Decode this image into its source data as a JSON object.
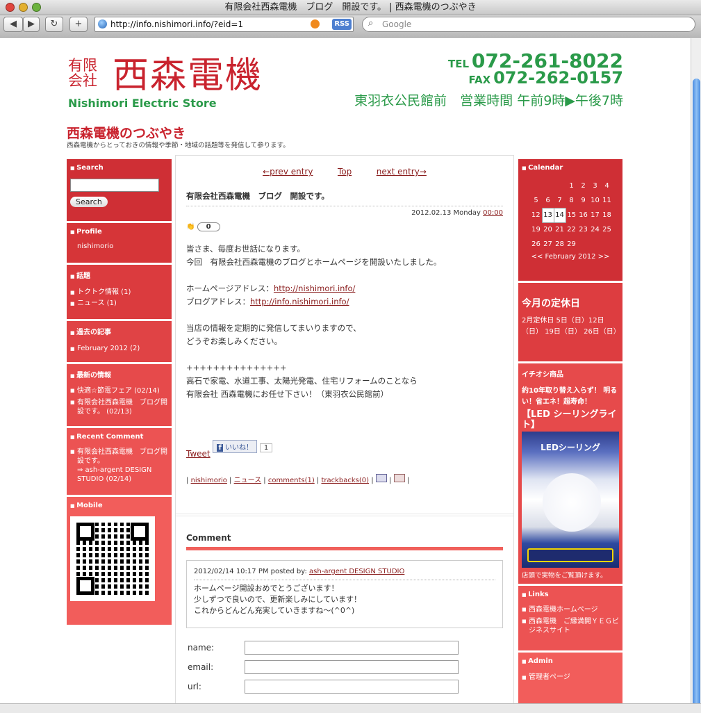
{
  "window": {
    "title": "有限会社西森電機　ブログ　開設です。 | 西森電機のつぶやき"
  },
  "toolbar": {
    "back": "◀",
    "forward": "▶",
    "reload": "↻",
    "add": "+",
    "url": "http://info.nishimori.info/?eid=1",
    "rss": "RSS",
    "search_placeholder": "Google"
  },
  "header": {
    "logo_small": "有限\n会社",
    "logo_main": "西森電機",
    "logo_en": "Nishimori Electric Store",
    "tel_label": "TEL",
    "tel": "072-261-8022",
    "fax_label": "FAX",
    "fax": "072-262-0157",
    "hours": "東羽衣公民館前　営業時間 午前9時▶午後7時"
  },
  "blog": {
    "title": "西森電機のつぶやき",
    "description": "西森電機からとっておきの情報や季節・地域の話題等を発信して参ります。"
  },
  "left": {
    "search_head": "Search",
    "search_button": "Search",
    "profile_head": "Profile",
    "profile_name": "nishimorio",
    "topics_head": "話題",
    "topics": [
      "トクトク情報 (1)",
      "ニュース (1)"
    ],
    "archive_head": "過去の記事",
    "archive": [
      "February 2012 (2)"
    ],
    "recent_head": "最新の情報",
    "recent": [
      "快適☆節電フェア (02/14)",
      "有限会社西森電機　ブログ開設です。 (02/13)"
    ],
    "comment_head": "Recent Comment",
    "comment_item": "有限会社西森電機　ブログ開設です。",
    "comment_by": "⇒ ash-argent DESIGN STUDIO (02/14)",
    "mobile_head": "Mobile"
  },
  "post": {
    "prev": "←prev entry",
    "top": "Top",
    "next": "next entry→",
    "title": "有限会社西森電機　ブログ　開設です。",
    "date": "2012.02.13 Monday",
    "time": "00:00",
    "clap": "0",
    "p1": "皆さま、毎度お世話になります。",
    "p2": "今回　有限会社西森電機のブログとホームページを開設いたしました。",
    "hp_label": "ホームページアドレス：",
    "hp_url": "http://nishimori.info/",
    "blog_label": "ブログアドレス：",
    "blog_url": "http://info.nishimori.info/",
    "p3": "当店の情報を定期的に発信してまいりますので、",
    "p4": "どうぞお楽しみください。",
    "p5": "+++++++++++++++",
    "p6": "高石で家電、水道工事、太陽光発電、住宅リフォームのことなら",
    "p7": "有限会社 西森電機にお任せ下さい！（東羽衣公民館前）",
    "tweet": "Tweet",
    "like": "いいね！",
    "like_count": "1",
    "author": "nishimorio",
    "category": "ニュース",
    "comments": "comments(1)",
    "trackbacks": "trackbacks(0)"
  },
  "comment": {
    "head": "Comment",
    "meta": "2012/02/14 10:17 PM posted by:",
    "author": "ash-argent DESIGN STUDIO",
    "l1": "ホームページ開設おめでとうございます！",
    "l2": "少しずつで良いので、更新楽しみにしています！",
    "l3": "これからどんどん充実していきますね〜(^0^)"
  },
  "form": {
    "name": "name:",
    "email": "email:",
    "url": "url:"
  },
  "right": {
    "cal_head": "Calendar",
    "cal_rows": [
      [
        "",
        "",
        "",
        "1",
        "2",
        "3",
        "4"
      ],
      [
        "5",
        "6",
        "7",
        "8",
        "9",
        "10",
        "11"
      ],
      [
        "12",
        "13",
        "14",
        "15",
        "16",
        "17",
        "18"
      ],
      [
        "19",
        "20",
        "21",
        "22",
        "23",
        "24",
        "25"
      ],
      [
        "26",
        "27",
        "28",
        "29",
        "",
        "",
        ""
      ]
    ],
    "cal_nav": "<< February 2012 >>",
    "holiday_head": "今月の定休日",
    "holiday_text": "2月定休日 5日（日）12日（日） 19日（日） 26日（日）",
    "pick_head": "イチオシ商品",
    "pick_text": "約10年取り替え入らず！ 明るい！省エネ！超寿命！",
    "pick_title": "【LED シーリングライト】",
    "pick_img": "LEDシーリング",
    "pick_caption": "店頭で実物をご覧頂けます。",
    "links_head": "Links",
    "links": [
      "西森電機ホームページ",
      "西森電機　ご縁満開ＹＥＧビジネスサイト"
    ],
    "admin_head": "Admin",
    "admin": [
      "管理者ページ"
    ]
  },
  "colors": {
    "red": "#c9232e",
    "green": "#2a9a49",
    "box1": "#cf2f35",
    "box2": "#e3474a",
    "box3": "#f2605b",
    "box4": "#f76f66"
  }
}
